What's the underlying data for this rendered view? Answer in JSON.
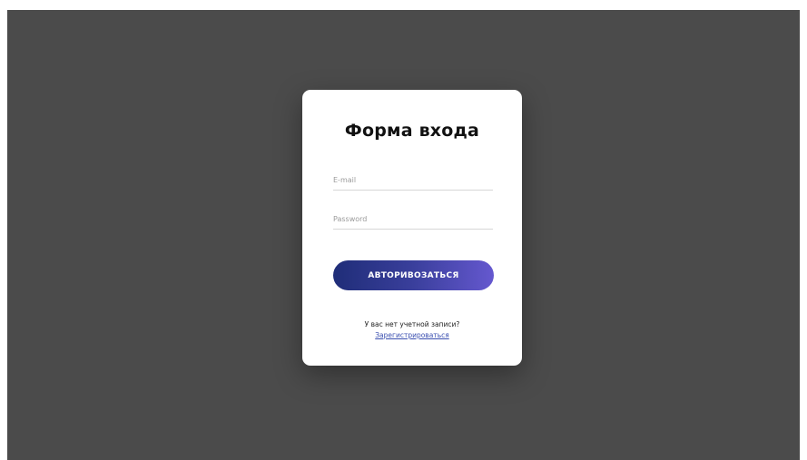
{
  "login_form": {
    "title": "Форма входа",
    "email_placeholder": "E-mail",
    "email_value": "",
    "password_placeholder": "Password",
    "password_value": "",
    "submit_label": "АВТОРИВОЗАТЬСЯ",
    "no_account_text": "У вас нет учетной записи?",
    "register_link": "Зарегистрироваться"
  },
  "colors": {
    "page_background": "#4b4b4b",
    "card_background": "#ffffff",
    "button_gradient_start": "#1f2d78",
    "button_gradient_end": "#6558cf",
    "link_color": "#3a4fb0"
  }
}
